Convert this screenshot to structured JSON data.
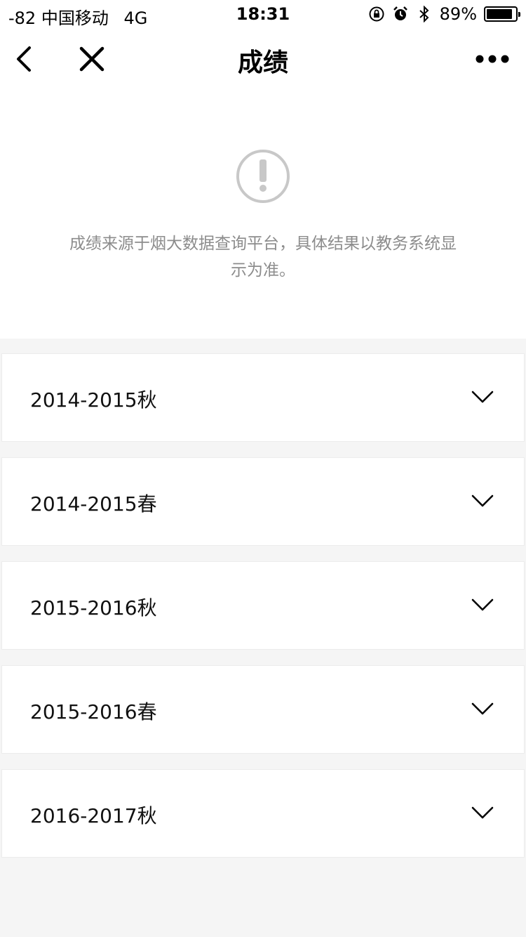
{
  "status_bar": {
    "signal": "-82",
    "carrier": "中国移动",
    "network": "4G",
    "time": "18:31",
    "battery_percent": "89%",
    "battery_level": 0.89,
    "icons": [
      "orientation-lock-icon",
      "alarm-icon",
      "bluetooth-icon",
      "battery-icon"
    ]
  },
  "nav": {
    "title": "成绩",
    "back_icon": "chevron-left-icon",
    "close_icon": "close-icon",
    "more_icon": "more-dots-icon"
  },
  "notice": {
    "icon": "exclamation-circle-icon",
    "line1": "成绩来源于烟大数据查询平台，具体结果以教务系统显",
    "line2": "示为准。"
  },
  "semesters": [
    {
      "label": "2014-2015秋"
    },
    {
      "label": "2014-2015春"
    },
    {
      "label": "2015-2016秋"
    },
    {
      "label": "2015-2016春"
    },
    {
      "label": "2016-2017秋"
    }
  ],
  "colors": {
    "background": "#f5f5f5",
    "card": "#ffffff",
    "notice_text": "#8c8c8c",
    "notice_icon": "#c8c8c8"
  }
}
